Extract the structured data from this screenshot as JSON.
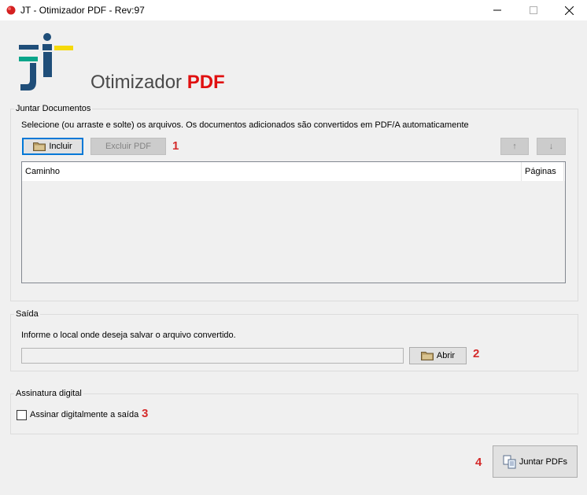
{
  "window": {
    "title": "JT - Otimizador PDF - Rev:97",
    "controls": {
      "minimize": "—",
      "maximize": "☐",
      "close": "✕"
    }
  },
  "brand": {
    "name": "Otimizador",
    "highlight": "PDF"
  },
  "juntar": {
    "group_title": "Juntar Documentos",
    "instructions": "Selecione (ou arraste e solte) os arquivos. Os documentos adicionados são convertidos em PDF/A automaticamente",
    "incluir_label": "Incluir",
    "excluir_label": "Excluir PDF",
    "up_label": "↑",
    "down_label": "↓",
    "step_number": "1",
    "columns": [
      "Caminho",
      "Páginas"
    ]
  },
  "saida": {
    "group_title": "Saída",
    "instructions": "Informe o local onde deseja salvar o arquivo convertido.",
    "path_value": "",
    "abrir_label": "Abrir",
    "step_number": "2"
  },
  "assinatura": {
    "group_title": "Assinatura digital",
    "checkbox_label": "Assinar digitalmente a saída",
    "checked": false,
    "step_number": "3"
  },
  "footer": {
    "step_number": "4",
    "juntar_label": "Juntar PDFs"
  },
  "colors": {
    "accent_red": "#e01010",
    "step_number": "#d42b2b",
    "focus_blue": "#0078d7",
    "logo_blue": "#1f4e79",
    "logo_teal": "#0aa58a",
    "logo_yellow": "#f5d90a"
  },
  "icons": {
    "app": "pdf-app-icon",
    "folder": "folder-icon",
    "merge": "merge-documents-icon"
  }
}
